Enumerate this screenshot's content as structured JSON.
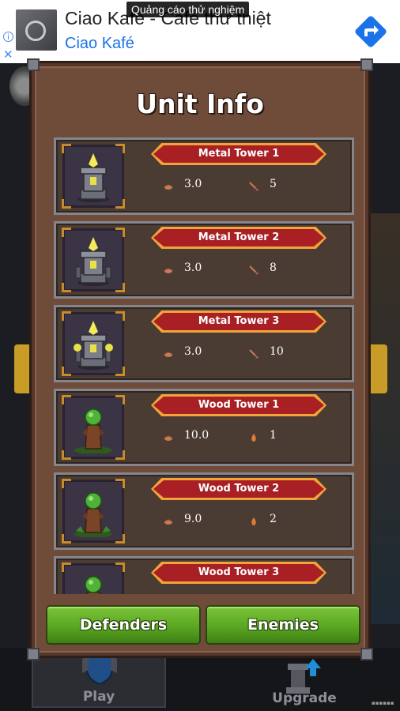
{
  "ad": {
    "label": "Quảng cáo thử nghiệm",
    "title": "Ciao Kafé - Cafe thư thiệt",
    "subtitle": "Ciao Kafé",
    "info_icon": "info-icon",
    "close_icon": "close-icon",
    "action_icon": "directions-arrow-icon"
  },
  "panel": {
    "title": "Unit Info"
  },
  "units": [
    {
      "name": "Metal Tower 1",
      "stat1": "3.0",
      "stat2": "5",
      "kind": "metal",
      "level": 1
    },
    {
      "name": "Metal Tower 2",
      "stat1": "3.0",
      "stat2": "8",
      "kind": "metal",
      "level": 2
    },
    {
      "name": "Metal Tower 3",
      "stat1": "3.0",
      "stat2": "10",
      "kind": "metal",
      "level": 3
    },
    {
      "name": "Wood Tower 1",
      "stat1": "10.0",
      "stat2": "1",
      "kind": "wood",
      "level": 1
    },
    {
      "name": "Wood Tower 2",
      "stat1": "9.0",
      "stat2": "2",
      "kind": "wood",
      "level": 2
    },
    {
      "name": "Wood Tower 3",
      "stat1": "",
      "stat2": "",
      "kind": "wood",
      "level": 3
    }
  ],
  "buttons": {
    "defenders": "Defenders",
    "enemies": "Enemies"
  },
  "nav": {
    "play": "Play",
    "upgrade": "Upgrade"
  },
  "colors": {
    "panel": "#6f4b3a",
    "card": "#4b3c33",
    "ribbon": "#a81f24",
    "ribbon_border": "#f2a33a",
    "button_green": "#5aa722"
  }
}
